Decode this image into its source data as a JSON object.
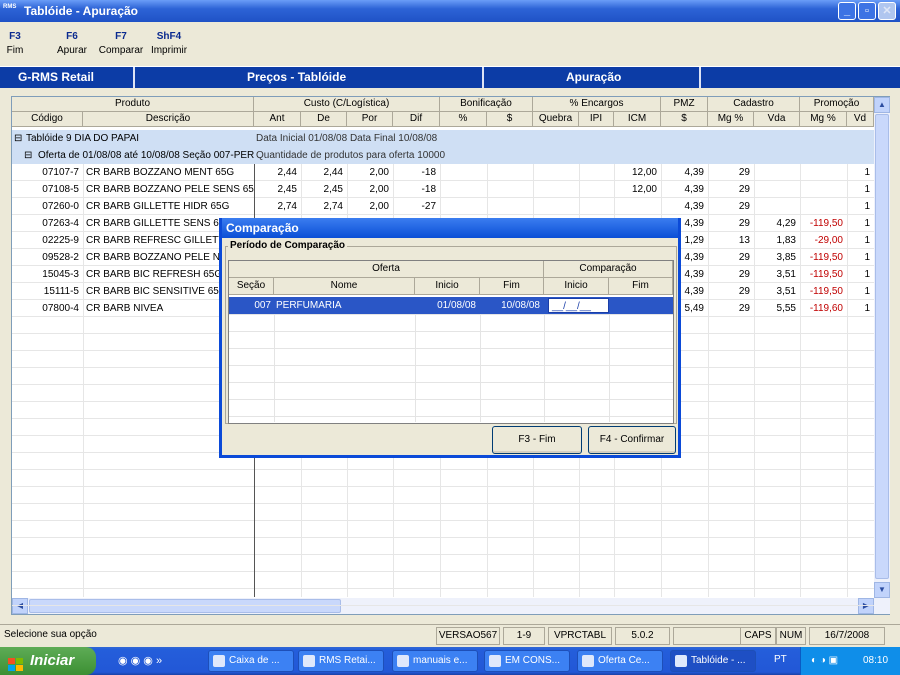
{
  "window": {
    "title": "Tablóide - Apuração",
    "logo_text": "RMS"
  },
  "toolbar": [
    {
      "key": "F3",
      "label": "Fim"
    },
    {
      "key": "F6",
      "label": "Apurar"
    },
    {
      "key": "F7",
      "label": "Comparar"
    },
    {
      "key": "ShF4",
      "label": "Imprimir"
    }
  ],
  "header_bar": {
    "brand": "G-RMS Retail",
    "module": "Preços - Tablóide",
    "screen": "Apuração"
  },
  "grid": {
    "group_headers": {
      "produto": "Produto",
      "custo": "Custo (C/Logística)",
      "bonificacao": "Bonificação",
      "encargos": "% Encargos",
      "pmz": "PMZ",
      "cadastro": "Cadastro",
      "promocao": "Promoção"
    },
    "columns": {
      "codigo": "Código",
      "descricao": "Descrição",
      "ant": "Ant",
      "de": "De",
      "por": "Por",
      "dif": "Dif",
      "bon_pct": "%",
      "bon_val": "$",
      "quebra": "Quebra",
      "ipi": "IPI",
      "icm": "ICM",
      "pmz": "$",
      "cad_mg": "Mg %",
      "cad_vda": "Vda",
      "promo_mg": "Mg %",
      "promo_vd": "Vd"
    },
    "tabloide": {
      "label": "Tablóide 9 DIA DO PAPAI",
      "info": "Data Inicial 01/08/08  Data Final 10/08/08"
    },
    "oferta": {
      "label": "Oferta de 01/08/08 até 10/08/08  Seção 007-PERF",
      "info": "Quantidade de produtos para oferta 10000"
    },
    "rows": [
      {
        "codigo": "07107-7",
        "descricao": "CR BARB BOZZANO MENT 65G",
        "ant": "2,44",
        "de": "2,44",
        "por": "2,00",
        "dif": "-18",
        "icm": "12,00",
        "pmz": "4,39",
        "cad_mg": "29",
        "cad_vda": "",
        "promo_mg": "",
        "promo_vd": "1"
      },
      {
        "codigo": "07108-5",
        "descricao": "CR BARB BOZZANO PELE SENS 65G",
        "ant": "2,45",
        "de": "2,45",
        "por": "2,00",
        "dif": "-18",
        "icm": "12,00",
        "pmz": "4,39",
        "cad_mg": "29",
        "cad_vda": "",
        "promo_mg": "",
        "promo_vd": "1"
      },
      {
        "codigo": "07260-0",
        "descricao": "CR BARB GILLETTE HIDR 65G",
        "ant": "2,74",
        "de": "2,74",
        "por": "2,00",
        "dif": "-27",
        "icm": "",
        "pmz": "4,39",
        "cad_mg": "29",
        "cad_vda": "",
        "promo_mg": "",
        "promo_vd": "1"
      },
      {
        "codigo": "07263-4",
        "descricao": "CR BARB GILLETTE SENS 65G",
        "ant": "",
        "de": "",
        "por": "",
        "dif": "",
        "icm": "",
        "pmz": "4,39",
        "cad_mg": "29",
        "cad_vda": "4,29",
        "promo_mg": "-119,50",
        "promo_vd": "1"
      },
      {
        "codigo": "02225-9",
        "descricao": "CR BARB REFRESC GILLETTE 65",
        "ant": "",
        "de": "",
        "por": "",
        "dif": "",
        "icm": "",
        "pmz": "1,29",
        "cad_mg": "13",
        "cad_vda": "1,83",
        "promo_mg": "-29,00",
        "promo_vd": "1"
      },
      {
        "codigo": "09528-2",
        "descricao": "CR BARB BOZZANO PELE NEGR",
        "ant": "",
        "de": "",
        "por": "",
        "dif": "",
        "icm": "",
        "pmz": "4,39",
        "cad_mg": "29",
        "cad_vda": "3,85",
        "promo_mg": "-119,50",
        "promo_vd": "1"
      },
      {
        "codigo": "15045-3",
        "descricao": "CR BARB BIC REFRESH 65G",
        "ant": "",
        "de": "",
        "por": "",
        "dif": "",
        "icm": "",
        "pmz": "4,39",
        "cad_mg": "29",
        "cad_vda": "3,51",
        "promo_mg": "-119,50",
        "promo_vd": "1"
      },
      {
        "codigo": "15111-5",
        "descricao": "CR BARB BIC SENSITIVE 65G",
        "ant": "",
        "de": "",
        "por": "",
        "dif": "",
        "icm": "",
        "pmz": "4,39",
        "cad_mg": "29",
        "cad_vda": "3,51",
        "promo_mg": "-119,50",
        "promo_vd": "1"
      },
      {
        "codigo": "07800-4",
        "descricao": "CR BARB NIVEA",
        "ant": "",
        "de": "",
        "por": "",
        "dif": "",
        "icm": "",
        "pmz": "5,49",
        "cad_mg": "29",
        "cad_vda": "5,55",
        "promo_mg": "-119,60",
        "promo_vd": "1"
      }
    ]
  },
  "dialog": {
    "title": "Comparação",
    "section": "Período de Comparação",
    "group_oferta": "Oferta",
    "group_comparacao": "Comparação",
    "cols": {
      "secao": "Seção",
      "nome": "Nome",
      "inicio": "Inicio",
      "fim": "Fim",
      "c_inicio": "Inicio",
      "c_fim": "Fim"
    },
    "row": {
      "secao": "007",
      "nome": "PERFUMARIA",
      "inicio": "01/08/08",
      "fim": "10/08/08",
      "c_inicio": "__/__/__",
      "c_fim": ""
    },
    "btn_fim": "F3 - Fim",
    "btn_confirmar": "F4 - Confirmar"
  },
  "status": {
    "message": "Selecione sua opção",
    "versao": "VERSAO567",
    "pages": "1-9",
    "program": "VPRCTABL",
    "release": "5.0.2",
    "caps": "CAPS",
    "num": "NUM",
    "date": "16/7/2008"
  },
  "taskbar": {
    "start": "Iniciar",
    "items": [
      "Caixa de ...",
      "RMS Retai...",
      "manuais e...",
      "EM CONS...",
      "Oferta Ce...",
      "Tablóide - ..."
    ],
    "lang": "PT",
    "clock": "08:10"
  }
}
